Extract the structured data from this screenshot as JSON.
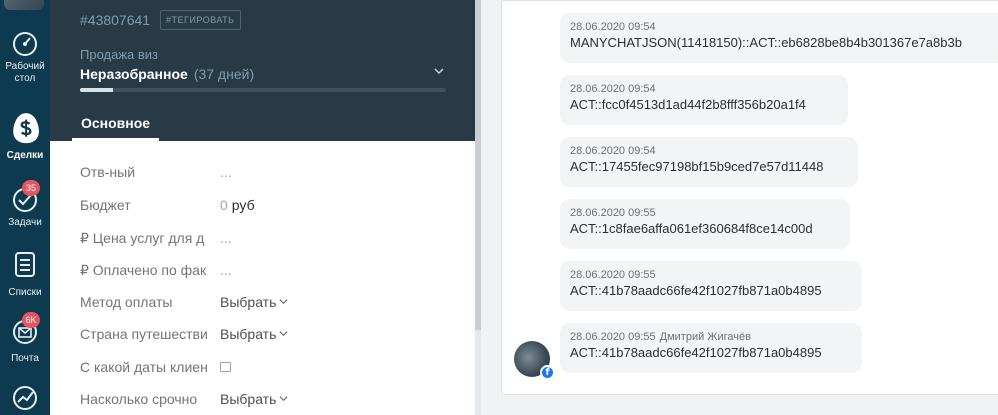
{
  "nav": {
    "items": [
      {
        "id": "dashboard",
        "label": "Рабочий стол",
        "icon": "speedometer-icon",
        "badge": ""
      },
      {
        "id": "leads",
        "label": "Сделки",
        "icon": "dollar-icon",
        "badge": "",
        "active": true
      },
      {
        "id": "tasks",
        "label": "Задачи",
        "icon": "check-circle-icon",
        "badge": "35"
      },
      {
        "id": "lists",
        "label": "Списки",
        "icon": "list-icon",
        "badge": ""
      },
      {
        "id": "mail",
        "label": "Почта",
        "icon": "envelope-icon",
        "badge": "6K"
      }
    ],
    "stats_icon": "chart-line-icon"
  },
  "lead": {
    "id": "#43807641",
    "tag_button": "#ТЕГИРОВАТЬ",
    "pipeline": "Продажа виз",
    "stage": "Неразобранное",
    "stage_days": "(37 дней)",
    "progress_fraction": 0.09,
    "tab": "Основное"
  },
  "fields": [
    {
      "label": "Отв-ный",
      "value": "..."
    },
    {
      "label": "Бюджет",
      "value": "0",
      "unit": "руб"
    },
    {
      "label": "₽ Цена услуг для д",
      "value": "..."
    },
    {
      "label": "₽ Оплачено по фак",
      "value": "..."
    },
    {
      "label": "Метод оплаты",
      "value": "Выбрать",
      "select": true
    },
    {
      "label": "Страна путешестви",
      "value": "Выбрать",
      "select": true
    },
    {
      "label": "С какой даты клиен",
      "value": "",
      "date": true
    },
    {
      "label": "Насколько срочно",
      "value": "Выбрать",
      "select": true
    }
  ],
  "feed": {
    "messages": [
      {
        "time": "28.06.2020 09:54",
        "author": "",
        "text": "MANYCHATJSON(11418150)::ACT::eb6828be8b4b301367e7a8b3b"
      },
      {
        "time": "28.06.2020 09:54",
        "author": "",
        "text": "ACT::fcc0f4513d1ad44f2b8fff356b20a1f4"
      },
      {
        "time": "28.06.2020 09:54",
        "author": "",
        "text": "ACT::17455fec97198bf15b9ced7e57d11448"
      },
      {
        "time": "28.06.2020 09:55",
        "author": "",
        "text": "ACT::1c8fae6affa061ef360684f8ce14c00d"
      },
      {
        "time": "28.06.2020 09:55",
        "author": "",
        "text": "ACT::41b78aadc66fe42f1027fb871a0b4895"
      },
      {
        "time": "28.06.2020 09:55",
        "author": "Дмитрий Жигачёв",
        "text": "ACT::41b78aadc66fe42f1027fb871a0b4895"
      }
    ]
  },
  "colors": {
    "nav_bg": "#0d3a4f",
    "header_bg": "#293a47",
    "badge": "#e5545f",
    "facebook": "#1877f2"
  }
}
